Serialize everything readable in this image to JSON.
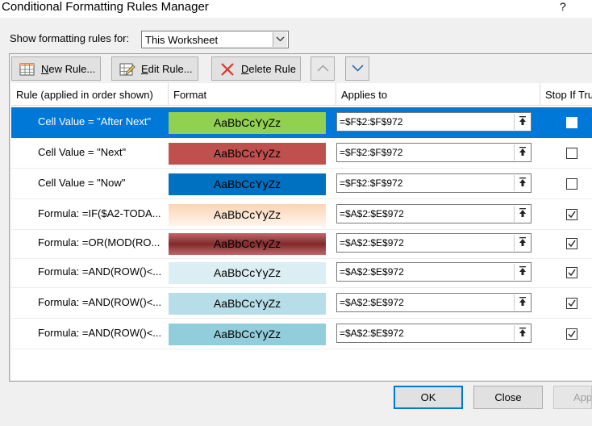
{
  "window": {
    "title": "Conditional Formatting Rules Manager",
    "help": "?"
  },
  "show_rules": {
    "label": "Show formatting rules for:",
    "selected": "This Worksheet"
  },
  "toolbar": {
    "new_rule": {
      "u": "N",
      "rest": "ew Rule..."
    },
    "edit_rule": {
      "u": "E",
      "rest": "dit Rule..."
    },
    "delete_rule": {
      "u": "D",
      "rest": "elete Rule"
    }
  },
  "columns": {
    "rule": "Rule (applied in order shown)",
    "format": "Format",
    "applies_to": "Applies to",
    "stop_if_true": "Stop If True"
  },
  "rules": [
    {
      "rule": "Cell Value = \"After Next\"",
      "format_preview": "AaBbCcYyZz",
      "format_color": "#92d050",
      "applies_to": "=$F$2:$F$972",
      "stop_if_true": false,
      "selected": true
    },
    {
      "rule": "Cell Value = \"Next\"",
      "format_preview": "AaBbCcYyZz",
      "format_color": "#c0504d",
      "applies_to": "=$F$2:$F$972",
      "stop_if_true": false,
      "selected": false
    },
    {
      "rule": "Cell Value = \"Now\"",
      "format_preview": "AaBbCcYyZz",
      "format_color": "#0070c0",
      "applies_to": "=$F$2:$F$972",
      "stop_if_true": false,
      "selected": false
    },
    {
      "rule": "Formula: =IF($A2-TODA...",
      "format_preview": "AaBbCcYyZz",
      "format_color": "#fbd5b5",
      "applies_to": "=$A$2:$E$972",
      "stop_if_true": true,
      "selected": false
    },
    {
      "rule": "Formula: =OR(MOD(RO...",
      "format_preview": "AaBbCcYyZz",
      "format_color": "#953735",
      "applies_to": "=$A$2:$E$972",
      "stop_if_true": true,
      "selected": false
    },
    {
      "rule": "Formula: =AND(ROW()<...",
      "format_preview": "AaBbCcYyZz",
      "format_color": "#daeef3",
      "applies_to": "=$A$2:$E$972",
      "stop_if_true": true,
      "selected": false
    },
    {
      "rule": "Formula: =AND(ROW()<...",
      "format_preview": "AaBbCcYyZz",
      "format_color": "#b7dee8",
      "applies_to": "=$A$2:$E$972",
      "stop_if_true": true,
      "selected": false
    },
    {
      "rule": "Formula: =AND(ROW()<...",
      "format_preview": "AaBbCcYyZz",
      "format_color": "#92cddc",
      "applies_to": "=$A$2:$E$972",
      "stop_if_true": true,
      "selected": false
    }
  ],
  "buttons": {
    "ok": "OK",
    "close": "Close",
    "apply": "Apply"
  },
  "colors": {
    "selection": "#0078d7"
  }
}
